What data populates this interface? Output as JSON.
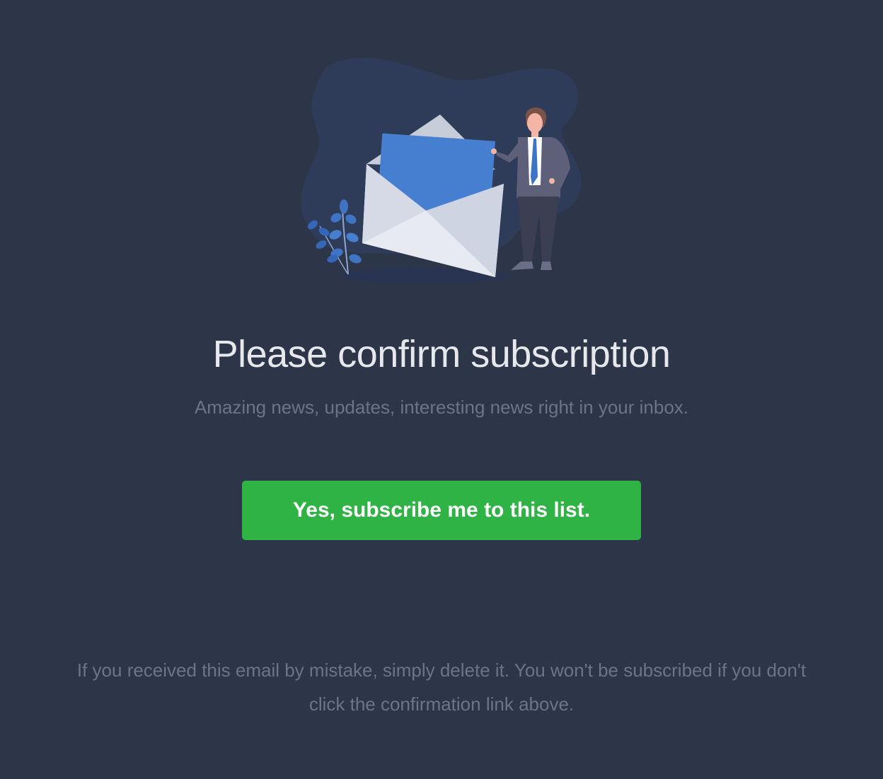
{
  "header": {
    "illustration": "envelope-with-businessman-illustration"
  },
  "main": {
    "title": "Please confirm subscription",
    "subtitle": "Amazing news, updates, interesting news right in your inbox.",
    "confirm_button_label": "Yes, subscribe me to this list."
  },
  "footer": {
    "note": "If you received this email by mistake, simply delete it. You won't be subscribed if you don't click the confirmation link above."
  },
  "colors": {
    "background": "#2d3648",
    "accent_green": "#2fb344",
    "title_text": "#e6e8ec",
    "muted_text": "#6b7588",
    "illustration_blue": "#467fd0"
  }
}
